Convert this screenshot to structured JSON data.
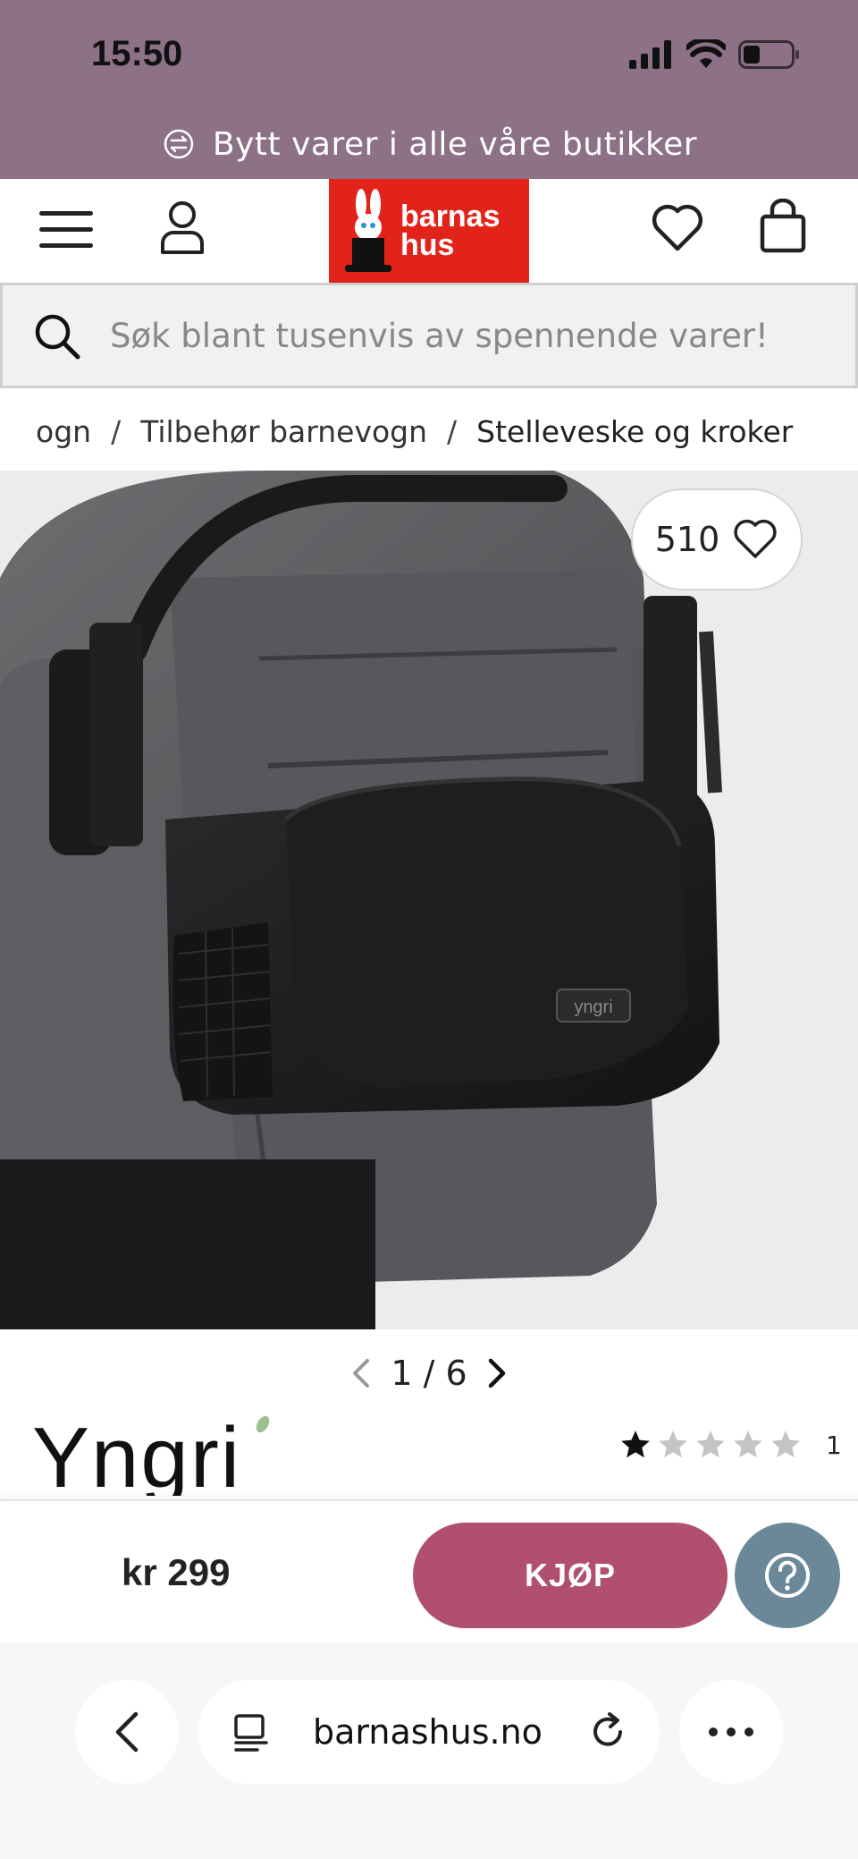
{
  "status_bar": {
    "time": "15:50",
    "icons": [
      "cellular-signal-icon",
      "wifi-icon",
      "battery-icon"
    ]
  },
  "promo": {
    "icon": "exchange-icon",
    "text": "Bytt varer i alle våre butikker"
  },
  "header": {
    "logo_text_line1": "barnas",
    "logo_text_line2": "hus",
    "logo_color": "#e2231a",
    "icons": [
      "menu-icon",
      "user-icon",
      "heart-icon",
      "bag-icon"
    ]
  },
  "search": {
    "placeholder": "Søk blant tusenvis av spennende varer!"
  },
  "breadcrumb": {
    "items": [
      "ogn",
      "Tilbehør barnevogn",
      "Stelleveske og kroker"
    ],
    "separator": "/"
  },
  "product": {
    "favorite_count": "510",
    "image_pager": "1 / 6",
    "brand": "Yngri",
    "bag_label": "yngri",
    "rating": {
      "stars": 1,
      "max": 5,
      "count": "1"
    },
    "price": "kr 299",
    "buy_label": "KJØP"
  },
  "colors": {
    "header_purple": "#8c7187",
    "buy_button": "#b04f6e",
    "help_button": "#6b8898"
  },
  "browser": {
    "url": "barnashus.no",
    "icons": [
      "back-icon",
      "reader-icon",
      "reload-icon",
      "more-icon"
    ]
  }
}
